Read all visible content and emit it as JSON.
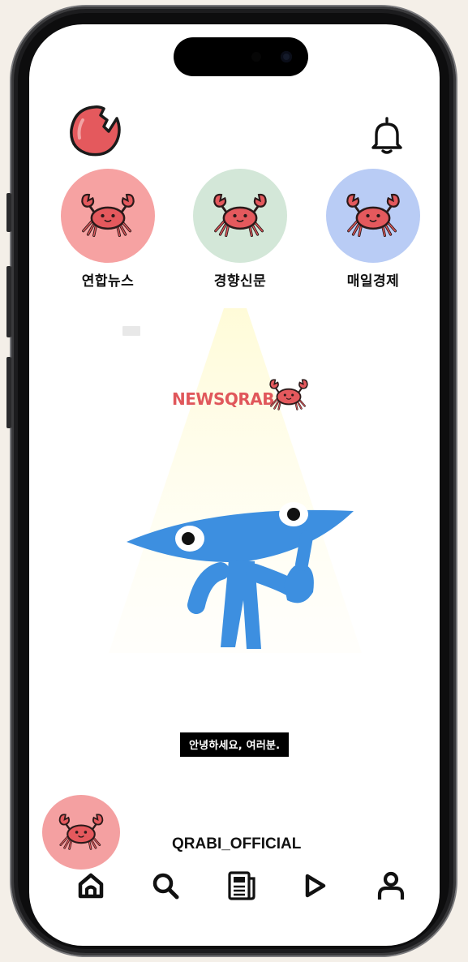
{
  "app": {
    "name": "NEWSQRAB",
    "brand_color": "#e0575b"
  },
  "header": {
    "logo_icon": "crab-claw-logo-icon",
    "notification_icon": "bell-icon"
  },
  "channels": [
    {
      "label": "연합뉴스",
      "circle_color": "#f6a2a2",
      "icon": "crab-icon"
    },
    {
      "label": "경향신문",
      "circle_color": "#d3e7d8",
      "icon": "crab-icon"
    },
    {
      "label": "매일경제",
      "circle_color": "#b9ccf5",
      "icon": "crab-icon"
    }
  ],
  "video": {
    "wordmark": "NEWSQRAB",
    "subtitle": "안녕하세요, 여러분."
  },
  "account": {
    "name": "QRABI_OFFICIAL",
    "avatar_color": "#f4a0a1"
  },
  "tabbar": {
    "items": [
      {
        "icon": "home-icon",
        "active": true
      },
      {
        "icon": "search-icon"
      },
      {
        "icon": "newspaper-icon"
      },
      {
        "icon": "play-icon"
      },
      {
        "icon": "profile-icon"
      }
    ]
  }
}
